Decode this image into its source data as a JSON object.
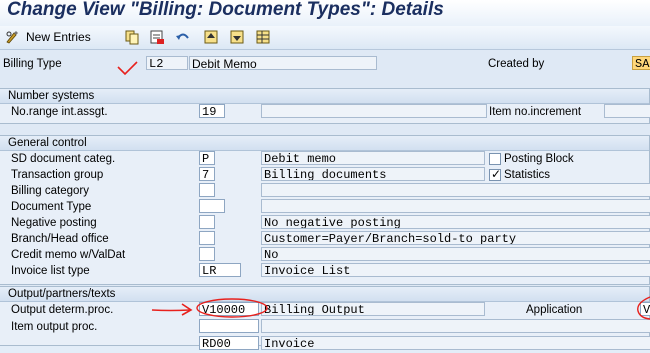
{
  "window": {
    "title": "Change View \"Billing: Document Types\": Details"
  },
  "toolbar": {
    "new_entries": "New Entries"
  },
  "header": {
    "billing_type_label": "Billing Type",
    "billing_type_value": "L2",
    "billing_type_desc": "Debit Memo",
    "created_by_label": "Created by",
    "created_by_value": "SA"
  },
  "number_systems": {
    "title": "Number systems",
    "range_label": "No.range int.assgt.",
    "range_value": "19",
    "item_increment_label": "Item no.increment"
  },
  "general_control": {
    "title": "General control",
    "sd_categ_label": "SD document categ.",
    "sd_categ_value": "P",
    "sd_categ_desc": "Debit memo",
    "posting_block_label": "Posting Block",
    "posting_block_checked": false,
    "transaction_group_label": "Transaction group",
    "transaction_group_value": "7",
    "transaction_group_desc": "Billing documents",
    "statistics_label": "Statistics",
    "statistics_checked": true,
    "billing_category_label": "Billing category",
    "document_type_label": "Document Type",
    "negative_posting_label": "Negative posting",
    "negative_posting_desc": "No negative posting",
    "branch_head_label": "Branch/Head office",
    "branch_head_desc": "Customer=Payer/Branch=sold-to party",
    "credit_memo_label": "Credit memo w/ValDat",
    "credit_memo_desc": "No",
    "invoice_list_label": "Invoice list type",
    "invoice_list_value": "LR",
    "invoice_list_desc": "Invoice List"
  },
  "output": {
    "title": "Output/partners/texts",
    "determ_proc_label": "Output determ.proc.",
    "determ_proc_value": "V10000",
    "determ_proc_desc": "Billing Output",
    "application_label": "Application",
    "application_value": "V",
    "item_output_label": "Item output proc.",
    "next_row_value": "RD00",
    "next_row_desc": "Invoice"
  },
  "colors": {
    "annotation_red": "#e8211d",
    "title_blue": "#1b2f60"
  }
}
